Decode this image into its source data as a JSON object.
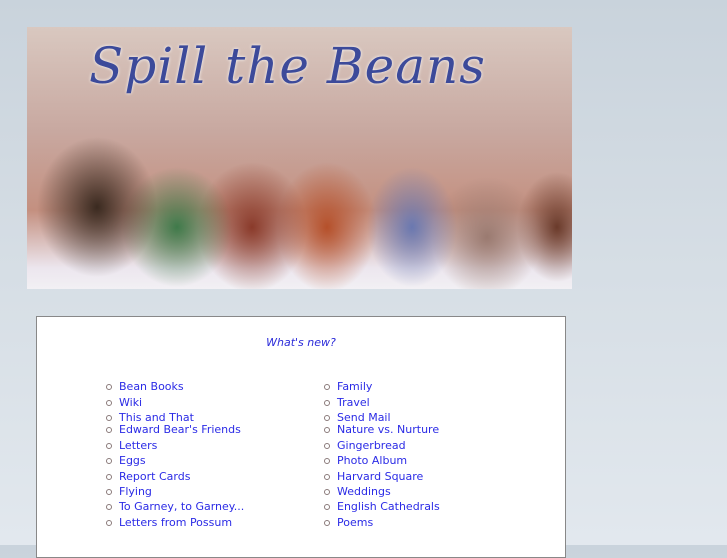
{
  "header": {
    "title": "Spill the Beans"
  },
  "main": {
    "whats_new": "What's new?",
    "left_links": [
      "Bean Books",
      "Wiki",
      "This and That",
      "Edward Bear's Friends",
      "Letters",
      "Eggs",
      "Report Cards",
      "Flying",
      "To Garney, to Garney...",
      "Letters from Possum"
    ],
    "right_links": [
      "Family",
      "Travel",
      "Send Mail",
      "Nature vs. Nurture",
      "Gingerbread",
      "Photo Album",
      "Harvard Square",
      "Weddings",
      "English Cathedrals",
      "Poems"
    ]
  }
}
